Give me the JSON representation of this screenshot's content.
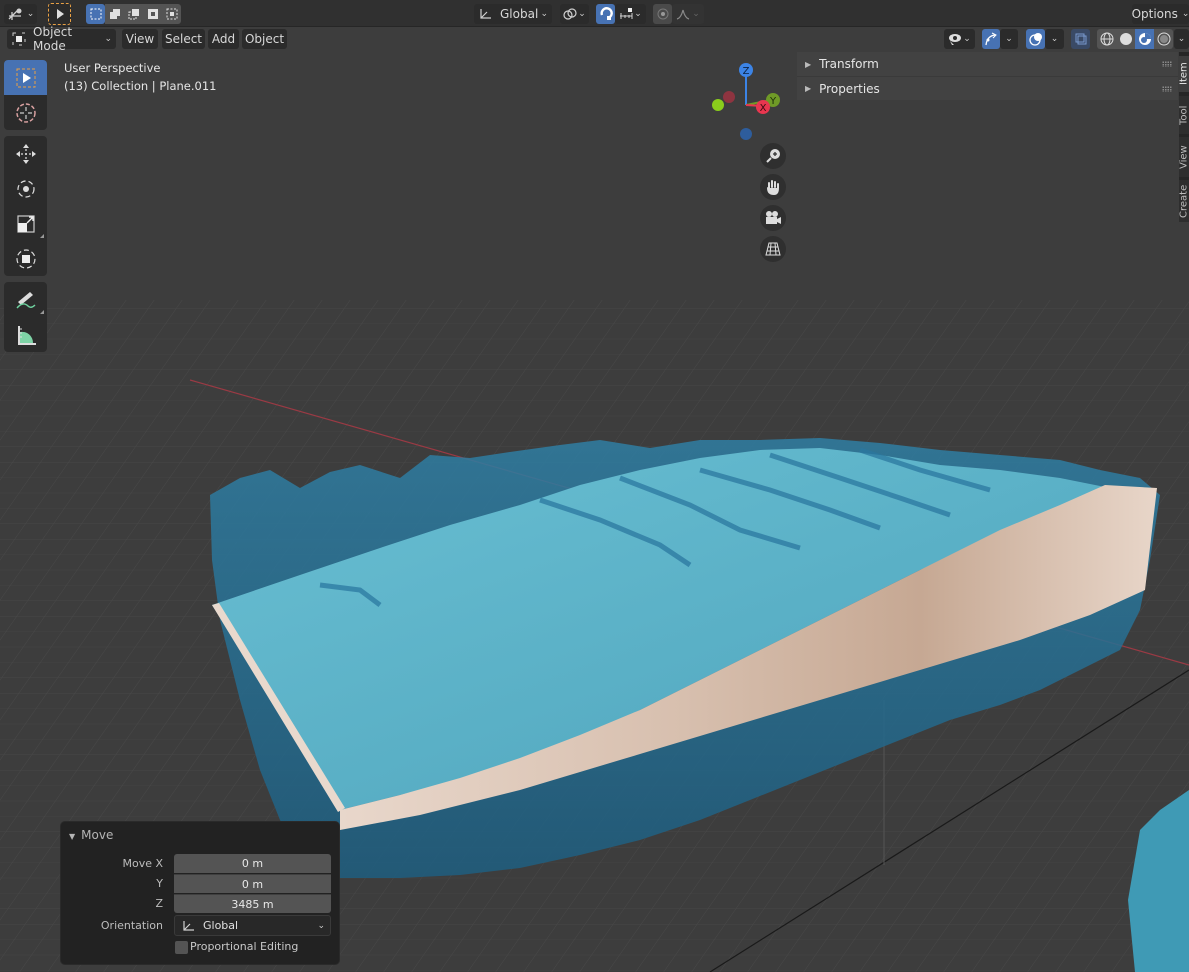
{
  "header": {
    "editor_type_icon": "3d-viewport-icon",
    "select_tool_icon": "select-box-icon",
    "select_modes": [
      "set-new-icon",
      "extend-icon",
      "subtract-icon",
      "invert-icon",
      "intersect-icon"
    ],
    "transform_orientation": "Global",
    "pivot_icon": "pivot-icon",
    "snap_icon": "snap-magnet-icon",
    "snap_increment_icon": "snap-increment-icon",
    "proportional_icon": "proportional-editing-icon",
    "falloff_icon": "falloff-icon",
    "options_label": "Options"
  },
  "header2": {
    "mode_label": "Object Mode",
    "menus": [
      "View",
      "Select",
      "Add",
      "Object"
    ],
    "right_icons": [
      "visibility-icon",
      "gizmo-icon",
      "overlay-icon",
      "xray-icon",
      "wireframe-shading-icon",
      "solid-shading-icon",
      "material-preview-icon",
      "rendered-shading-icon"
    ]
  },
  "viewport": {
    "view_name": "User Perspective",
    "object_info": "(13) Collection | Plane.011",
    "gizmo_axes": {
      "z": "Z",
      "y": "Y",
      "x": "X"
    },
    "axis_colors": {
      "x": "#e8364f",
      "y": "#6f9a27",
      "z": "#3c84e6",
      "neg_y": "#8acd1c"
    }
  },
  "toolbar": {
    "tools": [
      "select-box",
      "cursor",
      "move",
      "rotate",
      "scale",
      "transform",
      "annotate",
      "measure"
    ],
    "active": "select-box"
  },
  "sidebar": {
    "panels": [
      "Transform",
      "Properties"
    ],
    "tabs": [
      "Item",
      "Tool",
      "View",
      "Create"
    ],
    "active_tab": "Item"
  },
  "operator_panel": {
    "title": "Move",
    "fields": [
      {
        "label": "Move X",
        "value": "0 m"
      },
      {
        "label": "Y",
        "value": "0 m"
      },
      {
        "label": "Z",
        "value": "3485 m"
      }
    ],
    "orientation_label": "Orientation",
    "orientation_value": "Global",
    "proportional_label": "Proportional Editing",
    "proportional_checked": false
  },
  "colors": {
    "accent": "#4772b3",
    "header_bg": "#303030",
    "viewport_bg": "#3d3d3d",
    "water": "#4fa6c4",
    "terrain": "#e4cfc0"
  }
}
